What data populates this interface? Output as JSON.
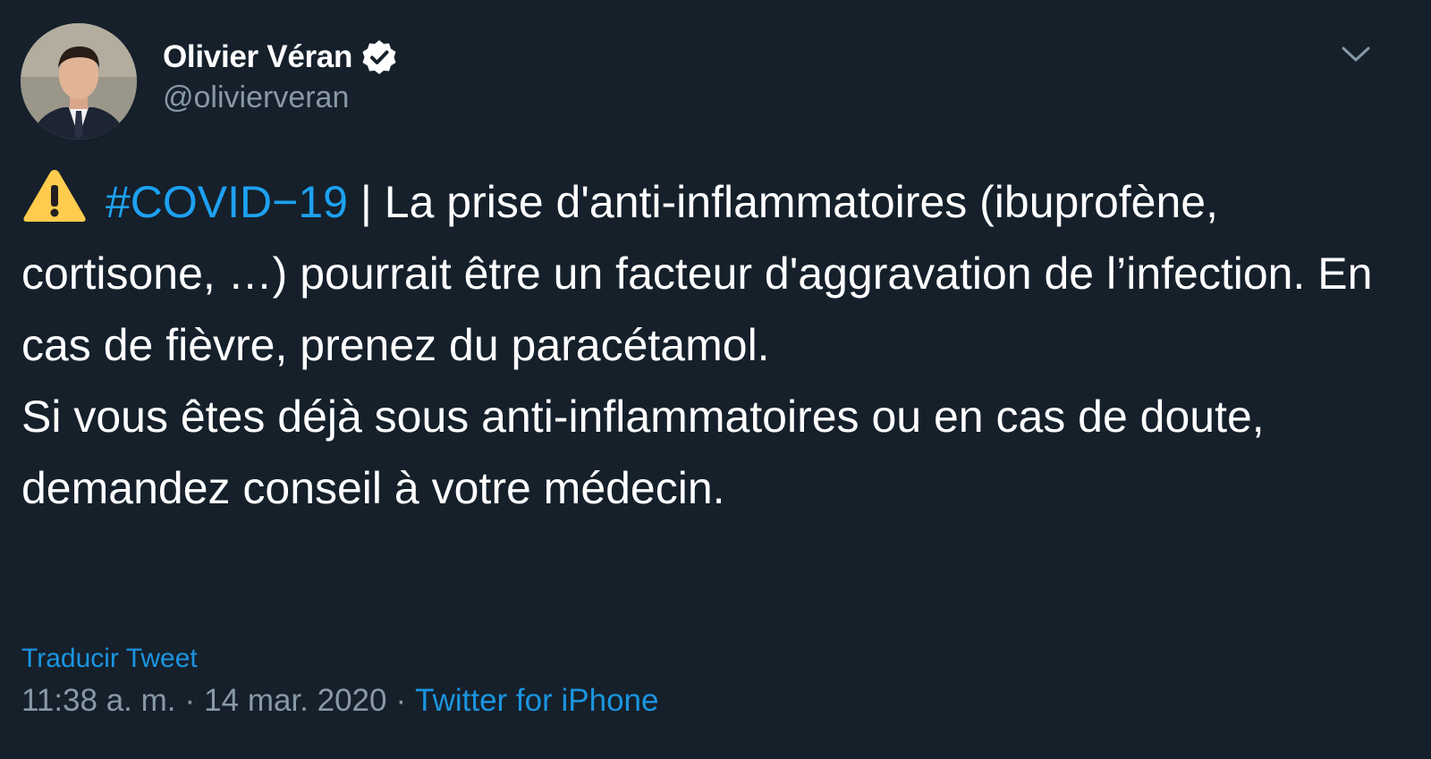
{
  "author": {
    "display_name": "Olivier Véran",
    "handle": "@olivierveran",
    "verified": true,
    "avatar_icon": "profile-photo"
  },
  "tweet": {
    "warning_emoji": "warning-icon",
    "hashtag": "#COVID−19",
    "text_after_hashtag": " | La prise d'anti-inflammatoires (ibuprofène, cortisone, …) pourrait être un facteur d'aggravation de l’infection. En cas de fièvre, prenez du paracétamol.\nSi vous êtes déjà sous anti-inflammatoires ou en cas de doute, demandez conseil à votre médecin."
  },
  "translate_label": "Traducir Tweet",
  "meta": {
    "time": "11:38 a. m.",
    "separator": "·",
    "date": "14 mar. 2020",
    "source": "Twitter for iPhone"
  },
  "colors": {
    "background": "#15202b",
    "link": "#1da1f2",
    "muted": "#8899a6"
  }
}
